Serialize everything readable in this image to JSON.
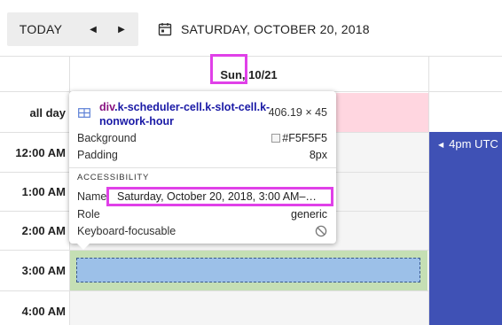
{
  "toolbar": {
    "today_label": "TODAY",
    "prev_icon": "◀",
    "next_icon": "▶",
    "date_label": "SATURDAY, OCTOBER 20, 2018",
    "calendar_icon": "calendar-icon"
  },
  "scheduler": {
    "day_header": "Sun, 10/21",
    "allday_label": "all day",
    "time_slots": [
      "12:00 AM",
      "1:00 AM",
      "2:00 AM",
      "3:00 AM",
      "4:00 AM"
    ],
    "event": {
      "label": "4pm UTC",
      "color": "#3f51b5"
    },
    "allday_color": "#ffd6e0",
    "selected_slot_color": "#9cc0e8"
  },
  "tooltip": {
    "tag": "div",
    "selector": ".k-scheduler-cell.k-slot-cell.k-nonwork-hour",
    "size": "406.19 × 45",
    "background_label": "Background",
    "background_value": "#F5F5F5",
    "padding_label": "Padding",
    "padding_value": "8px",
    "section_title": "ACCESSIBILITY",
    "name_label": "Name",
    "name_value": "Saturday, October 20, 2018, 3:00 AM–…",
    "role_label": "Role",
    "role_value": "generic",
    "focusable_label": "Keyboard-focusable"
  },
  "colors": {
    "highlight": "#e040e8",
    "nonwork": "#f5f5f5"
  }
}
